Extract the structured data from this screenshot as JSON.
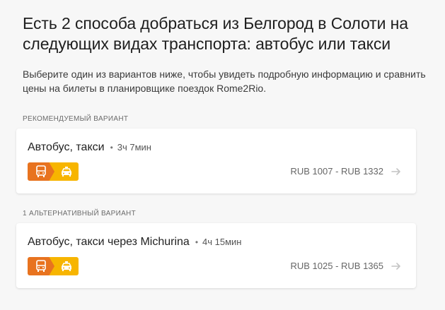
{
  "heading": {
    "title": "Есть 2 способа добраться из Белгород в Солоти на следующих видах транспорта: автобус или такси",
    "description": "Выберите один из вариантов ниже, чтобы увидеть подробную информацию и сравнить цены на билеты в планировщике поездок Rome2Rio."
  },
  "recommended": {
    "section_label": "РЕКОМЕНДУЕМЫЙ ВАРИАНТ",
    "route": {
      "name": "Автобус, такси",
      "separator": "•",
      "duration": "3ч 7мин",
      "modes": [
        "bus-icon",
        "taxi-icon"
      ],
      "price": "RUB 1007 - RUB 1332"
    }
  },
  "alternative": {
    "section_label": "1 АЛЬТЕРНАТИВНЫЙ ВАРИАНТ",
    "route": {
      "name": "Автобус, такси через Michurina",
      "separator": "•",
      "duration": "4ч 15мин",
      "modes": [
        "bus-icon",
        "taxi-icon"
      ],
      "price": "RUB 1025 - RUB 1365"
    }
  },
  "colors": {
    "bus": "#e8731f",
    "taxi": "#f7b500",
    "background": "#f7f7f7",
    "card": "#ffffff"
  }
}
